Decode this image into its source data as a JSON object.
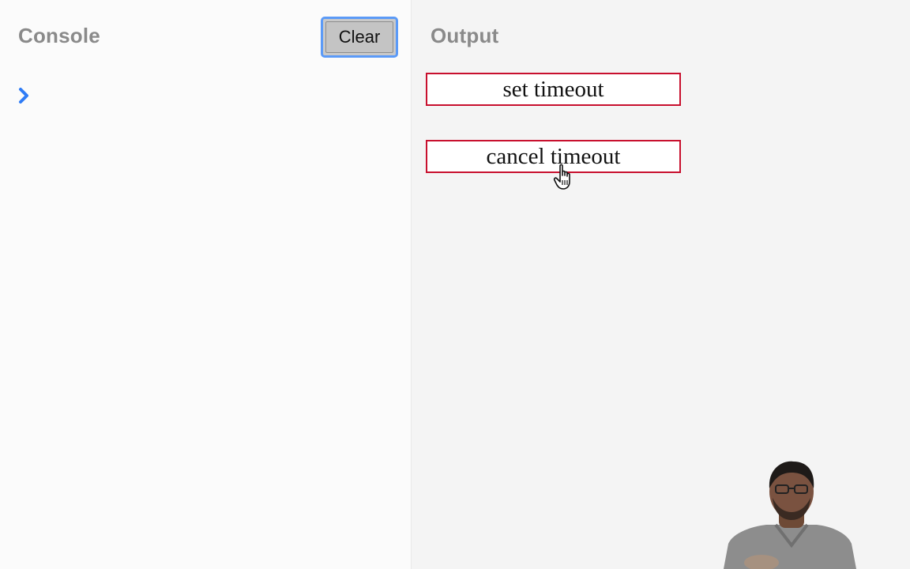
{
  "console": {
    "title": "Console",
    "clear_label": "Clear",
    "prompt_icon": "chevron-right-icon"
  },
  "output": {
    "title": "Output",
    "buttons": [
      {
        "label": "set timeout"
      },
      {
        "label": "cancel timeout"
      }
    ]
  },
  "cursor": {
    "icon": "hand-pointer-icon"
  },
  "colors": {
    "title_gray": "#8a8a8a",
    "clear_focus": "#5b9af7",
    "prompt_blue": "#2f7cf6",
    "button_border": "#c8102e"
  }
}
